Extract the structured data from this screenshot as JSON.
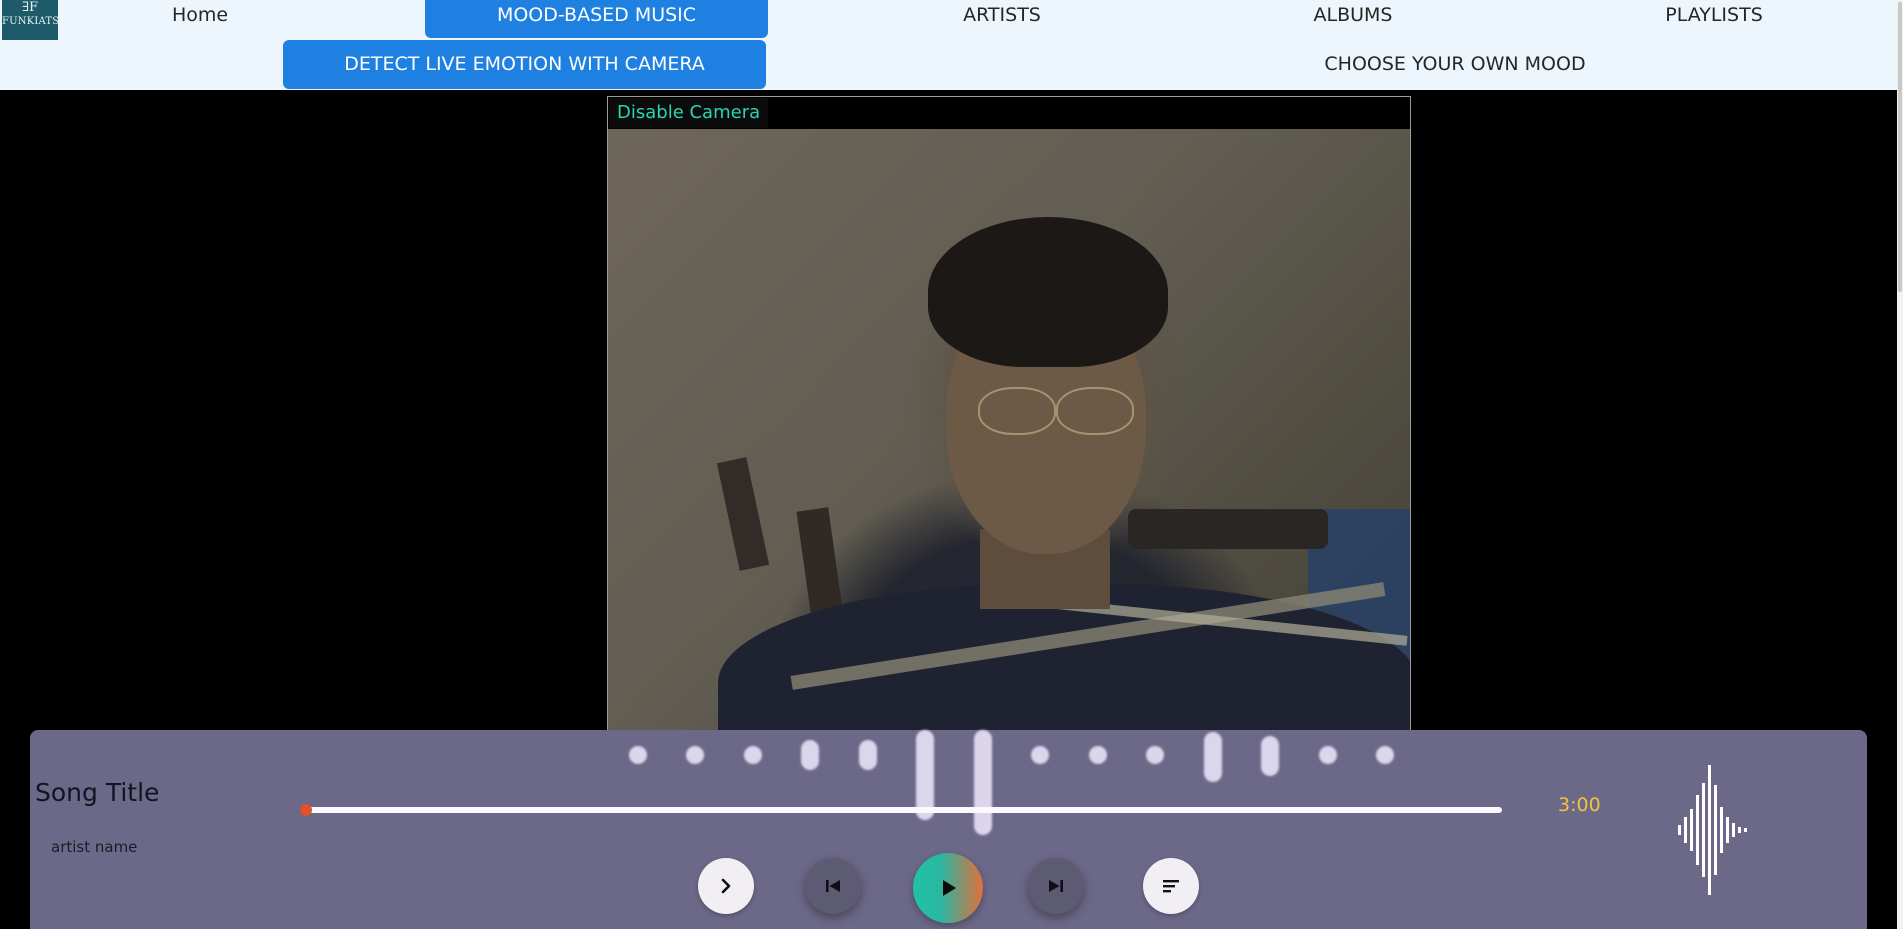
{
  "logo": {
    "mark": "∃F",
    "name": "FUNKIATS",
    "tagline": "..."
  },
  "nav": {
    "items": [
      {
        "label": "Home"
      },
      {
        "label": "MOOD-BASED MUSIC"
      },
      {
        "label": "ARTISTS"
      },
      {
        "label": "ALBUMS"
      },
      {
        "label": "PLAYLISTS"
      }
    ],
    "active_index": 1
  },
  "subnav": {
    "items": [
      {
        "label": "DETECT LIVE EMOTION WITH CAMERA"
      },
      {
        "label": "CHOOSE YOUR OWN MOOD"
      }
    ],
    "active_index": 0
  },
  "camera": {
    "toggle_label": "Disable Camera"
  },
  "player": {
    "song_title": "Song Title",
    "artist_name": "artist name",
    "duration": "3:00",
    "progress": 0.0,
    "controls": {
      "expand_icon": "chevron-right-icon",
      "prev_icon": "skip-previous-icon",
      "play_icon": "play-icon",
      "next_icon": "skip-next-icon",
      "queue_icon": "queue-list-icon",
      "visualizer_icon": "sound-wave-icon"
    }
  },
  "colors": {
    "nav_active": "#1e80e0",
    "toggle_text": "#29d6b4",
    "player_bg": "#6c6888",
    "duration_text": "#f3c241",
    "progress_knob": "#e0512c"
  }
}
